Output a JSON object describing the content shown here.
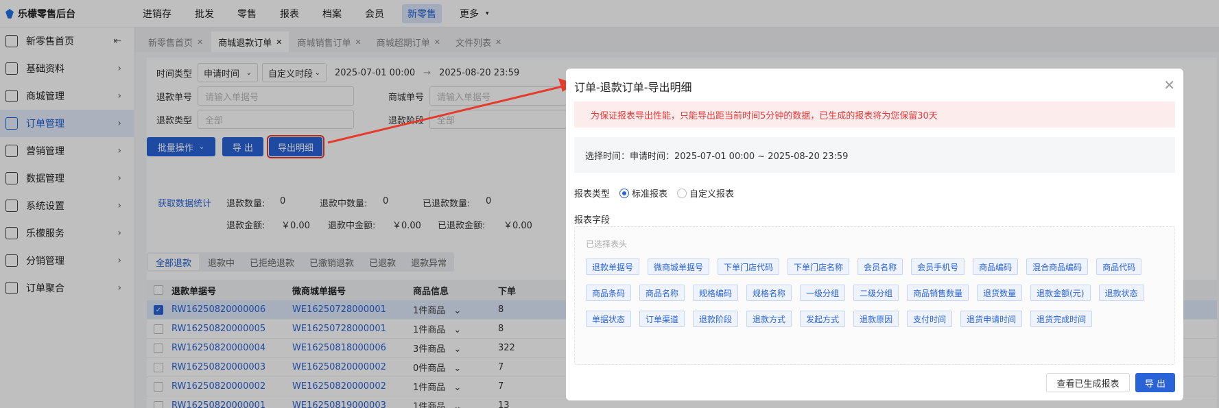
{
  "app": {
    "title": "乐檬零售后台"
  },
  "topnav": [
    {
      "label": "进销存",
      "active": false
    },
    {
      "label": "批发",
      "active": false
    },
    {
      "label": "零售",
      "active": false
    },
    {
      "label": "报表",
      "active": false
    },
    {
      "label": "档案",
      "active": false
    },
    {
      "label": "会员",
      "active": false
    },
    {
      "label": "新零售",
      "active": true
    },
    {
      "label": "更多",
      "active": false
    }
  ],
  "sidebar": {
    "collapse_icon": "collapse-icon",
    "items": [
      {
        "label": "新零售首页",
        "icon": "home-icon"
      },
      {
        "label": "基础资料",
        "icon": "grid-icon"
      },
      {
        "label": "商城管理",
        "icon": "store-icon"
      },
      {
        "label": "订单管理",
        "icon": "order-icon",
        "active": true
      },
      {
        "label": "营销管理",
        "icon": "marketing-icon"
      },
      {
        "label": "数据管理",
        "icon": "chart-icon"
      },
      {
        "label": "系统设置",
        "icon": "gear-icon"
      },
      {
        "label": "乐檬服务",
        "icon": "service-icon"
      },
      {
        "label": "分销管理",
        "icon": "distribution-icon"
      },
      {
        "label": "订单聚合",
        "icon": "aggregate-icon"
      }
    ]
  },
  "tabs": [
    {
      "label": "新零售首页",
      "active": false
    },
    {
      "label": "商城退款订单",
      "active": true
    },
    {
      "label": "商城销售订单",
      "active": false
    },
    {
      "label": "商城超期订单",
      "active": false
    },
    {
      "label": "文件列表",
      "active": false
    }
  ],
  "filters": {
    "time_type_label": "时间类型",
    "time_type_value": "申请时间",
    "period_value": "自定义时段",
    "date_start": "2025-07-01 00:00",
    "date_arrow": "→",
    "date_end": "2025-08-20 23:59",
    "refund_no_label": "退款单号",
    "refund_no_placeholder": "请输入单据号",
    "mall_no_label": "商城单号",
    "mall_no_placeholder": "请输入单据号",
    "refund_type_label": "退款类型",
    "refund_type_value": "全部",
    "refund_stage_label": "退款阶段",
    "refund_stage_value": "全部"
  },
  "actions": {
    "batch_label": "批量操作",
    "export_label": "导 出",
    "export_detail_label": "导出明细"
  },
  "stats": {
    "fetch_label": "获取数据统计",
    "refund_count_label": "退款数量:",
    "refund_count": "0",
    "refunding_count_label": "退款中数量:",
    "refunding_count": "0",
    "refunded_count_label": "已退款数量:",
    "refunded_count": "0",
    "refund_amount_label": "退款金额:",
    "refund_amount": "￥0.00",
    "refunding_amount_label": "退款中金额:",
    "refunding_amount": "￥0.00",
    "refunded_amount_label": "已退款金额:",
    "refunded_amount": "￥0.00"
  },
  "subtabs": [
    {
      "label": "全部退款",
      "active": true
    },
    {
      "label": "退款中",
      "active": false
    },
    {
      "label": "已拒绝退款",
      "active": false
    },
    {
      "label": "已撤销退款",
      "active": false
    },
    {
      "label": "已退款",
      "active": false
    },
    {
      "label": "退款异常",
      "active": false
    }
  ],
  "table": {
    "headers": [
      "退款单据号",
      "微商城单据号",
      "商品信息",
      "下单"
    ],
    "rows": [
      {
        "refund_no": "RW16250820000006",
        "mall_no": "WE16250728000001",
        "goods": "1件商品",
        "qty": "8",
        "checked": true
      },
      {
        "refund_no": "RW16250820000005",
        "mall_no": "WE16250728000001",
        "goods": "1件商品",
        "qty": "8",
        "checked": false
      },
      {
        "refund_no": "RW16250820000004",
        "mall_no": "WE16250818000006",
        "goods": "3件商品",
        "qty": "322",
        "checked": false
      },
      {
        "refund_no": "RW16250820000003",
        "mall_no": "WE16250820000002",
        "goods": "0件商品",
        "qty": "7",
        "checked": false
      },
      {
        "refund_no": "RW16250820000002",
        "mall_no": "WE16250820000002",
        "goods": "1件商品",
        "qty": "7",
        "checked": false
      },
      {
        "refund_no": "RW16250820000001",
        "mall_no": "WE16250819000003",
        "goods": "1件商品",
        "qty": "13",
        "checked": false
      }
    ]
  },
  "modal": {
    "title": "订单-退款订单-导出明细",
    "close_icon": "close-icon",
    "warning": "为保证报表导出性能，只能导出距当前时间5分钟的数据，已生成的报表将为您保留30天",
    "selected_time": "选择时间：申请时间：2025-07-01 00:00 ~ 2025-08-20 23:59",
    "report_type_label": "报表类型",
    "report_type_standard": "标准报表",
    "report_type_custom": "自定义报表",
    "fields_label": "报表字段",
    "selected_header_hint": "已选择表头",
    "fields": [
      "退款单据号",
      "微商城单据号",
      "下单门店代码",
      "下单门店名称",
      "会员名称",
      "会员手机号",
      "商品编码",
      "混合商品编码",
      "商品代码",
      "商品条码",
      "商品名称",
      "规格编码",
      "规格名称",
      "一级分组",
      "二级分组",
      "商品销售数量",
      "退货数量",
      "退款金额(元)",
      "退款状态",
      "单据状态",
      "订单渠道",
      "退款阶段",
      "退款方式",
      "发起方式",
      "退款原因",
      "支付时间",
      "退货申请时间",
      "退货完成时间"
    ],
    "view_reports_label": "查看已生成报表",
    "export_label": "导 出"
  },
  "colors": {
    "accent": "#2a63d8",
    "warning_bg": "#fdecec",
    "warning_text": "#e63939",
    "annotation_red": "#e53b2c"
  }
}
